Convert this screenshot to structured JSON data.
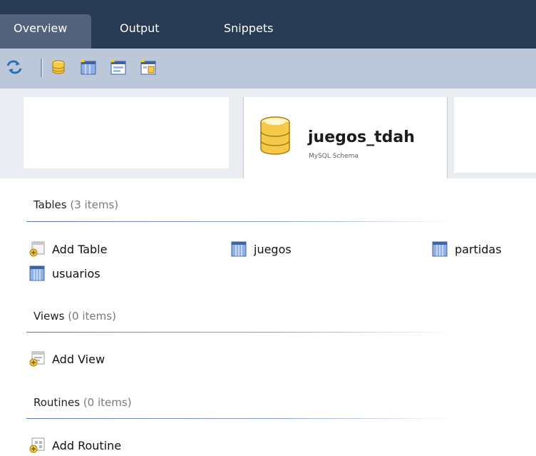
{
  "tabs": [
    {
      "label": "Overview",
      "active": true
    },
    {
      "label": "Output",
      "active": false
    },
    {
      "label": "Snippets",
      "active": false
    }
  ],
  "toolbar": {
    "buttons": [
      "refresh-icon",
      "add-schema-icon",
      "add-table-icon",
      "add-view-icon",
      "add-routine-icon"
    ]
  },
  "schema": {
    "name": "juegos_tdah",
    "type": "MySQL Schema"
  },
  "sections": {
    "tables": {
      "title": "Tables",
      "count": "(3 items)",
      "items": [
        {
          "label": "Add Table",
          "icon": "add-table-icon"
        },
        {
          "label": "juegos",
          "icon": "table-icon"
        },
        {
          "label": "partidas",
          "icon": "table-icon"
        },
        {
          "label": "usuarios",
          "icon": "table-icon"
        }
      ]
    },
    "views": {
      "title": "Views",
      "count": "(0 items)",
      "items": [
        {
          "label": "Add View",
          "icon": "add-view-icon"
        }
      ]
    },
    "routines": {
      "title": "Routines",
      "count": "(0 items)",
      "items": [
        {
          "label": "Add Routine",
          "icon": "add-routine-icon"
        }
      ]
    }
  },
  "colors": {
    "tabbar": "#283b55",
    "active_tab": "#52637b",
    "toolbar": "#bcc8d9",
    "section_line": "#5a76ad"
  }
}
